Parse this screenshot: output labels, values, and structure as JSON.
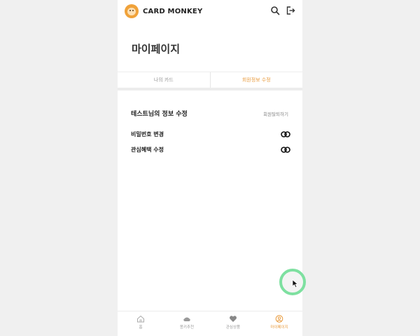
{
  "app": {
    "brand": "CARD MONKEY",
    "colors": {
      "accent": "#e89a3c",
      "background": "#f0f0f0",
      "fab_ring": "#7ee0a0"
    }
  },
  "header": {
    "icons": [
      "search-icon",
      "logout-icon"
    ]
  },
  "page": {
    "title": "마이페이지"
  },
  "tabs": [
    {
      "label": "나의 카드",
      "active": false
    },
    {
      "label": "회원정보 수정",
      "active": true
    }
  ],
  "section": {
    "title": "테스트님의 정보 수정",
    "withdraw_label": "회원탈퇴하기",
    "items": [
      {
        "label": "비밀번호 변경",
        "icon": "toggle-link-icon"
      },
      {
        "label": "관심혜택 수정",
        "icon": "toggle-link-icon"
      }
    ]
  },
  "bottom_nav": [
    {
      "label": "홈",
      "icon": "home-icon",
      "active": false
    },
    {
      "label": "몽키추천",
      "icon": "monkey-icon",
      "active": false
    },
    {
      "label": "관심상품",
      "icon": "heart-icon",
      "active": false
    },
    {
      "label": "마이페이지",
      "icon": "user-icon",
      "active": true
    }
  ]
}
